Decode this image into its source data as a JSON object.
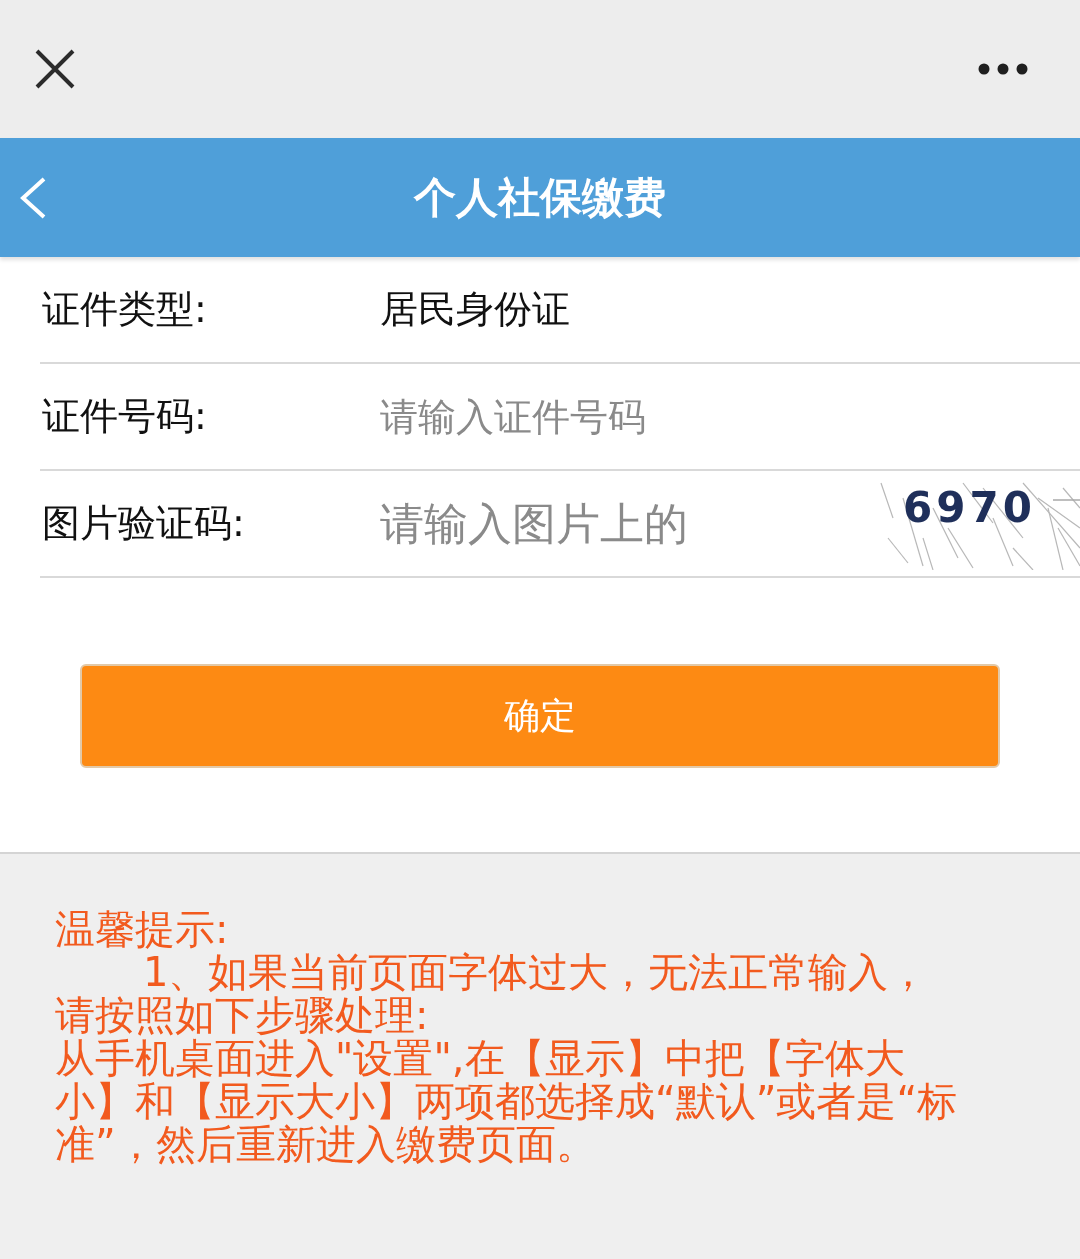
{
  "header": {
    "title": "个人社保缴费"
  },
  "form": {
    "rows": [
      {
        "kind": "value",
        "label": "证件类型:",
        "value": "居民身份证"
      },
      {
        "kind": "input",
        "label": "证件号码:",
        "placeholder": "请输入证件号码"
      },
      {
        "kind": "captcha",
        "label": "图片验证码:",
        "placeholder": "请输入图片上的",
        "captcha": "6970"
      }
    ]
  },
  "submit_button": {
    "label": "确定"
  },
  "tips": {
    "title": "温馨提示:",
    "paragraphs": [
      {
        "indent": true,
        "lines": [
          "1、如果当前页面字体过大，无法正常输入，",
          "请按照如下步骤处理:"
        ]
      },
      {
        "indent": false,
        "lines": [
          "从手机桌面进入\"设置\",在【显示】中把【字体大",
          "小】和【显示大小】两项都选择成“默认”或者是“标",
          "准”，然后重新进入缴费页面。"
        ]
      }
    ]
  }
}
